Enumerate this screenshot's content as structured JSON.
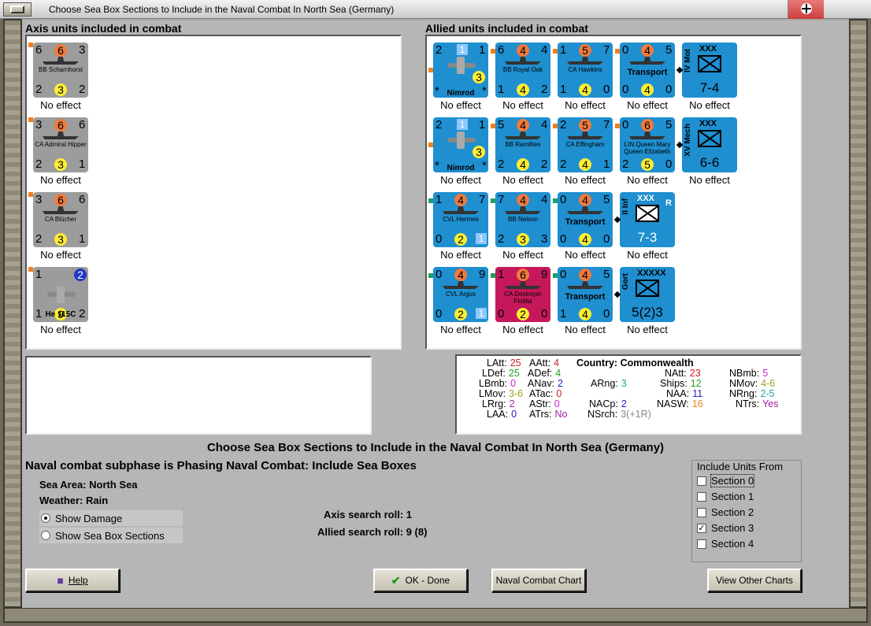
{
  "window": {
    "title": "Choose Sea Box Sections to Include in the Naval Combat In North Sea (Germany)"
  },
  "axis_panel": {
    "label": "Axis units included in combat"
  },
  "allied_panel": {
    "label": "Allied units included in combat"
  },
  "axis_units": [
    {
      "name": "BB Scharnhorst",
      "tl": "6",
      "circle": "6",
      "tr": "3",
      "bl": "2",
      "yc": "3",
      "br": "2",
      "effect": "No effect"
    },
    {
      "name": "CA Admiral Hipper",
      "tl": "3",
      "circle": "6",
      "tr": "6",
      "bl": "2",
      "yc": "3",
      "br": "1",
      "effect": "No effect"
    },
    {
      "name": "CA Blücher",
      "tl": "3",
      "circle": "6",
      "tr": "6",
      "bl": "2",
      "yc": "3",
      "br": "1",
      "effect": "No effect"
    },
    {
      "name": "He 115C",
      "tl": "1",
      "circle": "2",
      "bl": "1",
      "yc": "9",
      "br": "2",
      "effect": "No effect"
    }
  ],
  "allied_units": [
    {
      "name": "Nimrod",
      "tl": "2",
      "sq": "1",
      "tr": "1",
      "yc": "3",
      "star_l": "*",
      "star_r": "*",
      "effect": "No effect"
    },
    {
      "name": "BB Royal Oak",
      "tl": "6",
      "circle": "4",
      "tr": "4",
      "bl": "1",
      "yc": "4",
      "br": "2",
      "effect": "No effect"
    },
    {
      "name": "CA Hawkins",
      "tl": "1",
      "circle": "5",
      "tr": "7",
      "bl": "1",
      "yc": "4",
      "br": "0",
      "effect": "No effect"
    },
    {
      "name": "Transport",
      "tl": "0",
      "circle": "4",
      "tr": "5",
      "bl": "0",
      "yc": "4",
      "br": "0",
      "effect": "No effect"
    },
    {
      "name": "IV Mot",
      "type": "XXX",
      "strength": "7-4",
      "effect": "No effect"
    },
    {
      "name": "Nimrod",
      "tl": "2",
      "sq": "1",
      "tr": "1",
      "yc": "3",
      "star_l": "*",
      "star_r": "*",
      "effect": "No effect"
    },
    {
      "name": "BB Ramillies",
      "tl": "5",
      "circle": "4",
      "tr": "4",
      "bl": "2",
      "yc": "4",
      "br": "2",
      "effect": "No effect"
    },
    {
      "name": "CA Effingham",
      "tl": "2",
      "circle": "5",
      "tr": "7",
      "bl": "2",
      "yc": "4",
      "br": "1",
      "effect": "No effect"
    },
    {
      "name": "LIN Queen Mary Queen Elizabeth",
      "tl": "0",
      "circle": "6",
      "tr": "5",
      "bl": "2",
      "yc": "5",
      "br": "0",
      "effect": "No effect"
    },
    {
      "name": "XV Mech",
      "type": "XXX",
      "strength": "6-6",
      "effect": "No effect"
    },
    {
      "name": "CVL Hermes",
      "tl": "1",
      "circle": "4",
      "tr": "7",
      "bl": "0",
      "yc": "2",
      "sq": "1",
      "effect": "No effect"
    },
    {
      "name": "BB Nelson",
      "tl": "7",
      "circle": "4",
      "tr": "4",
      "bl": "2",
      "yc": "3",
      "br": "3",
      "effect": "No effect"
    },
    {
      "name": "Transport",
      "tl": "0",
      "circle": "4",
      "tr": "5",
      "bl": "0",
      "yc": "4",
      "br": "0",
      "effect": "No effect"
    },
    {
      "name": "II Inf",
      "type": "XXX",
      "extra": "R",
      "strength": "7-3",
      "effect": "No effect"
    },
    {
      "name": "CVL Argus",
      "tl": "0",
      "circle": "4",
      "tr": "9",
      "bl": "0",
      "yc": "2",
      "sq": "1",
      "effect": "No effect"
    },
    {
      "name": "CA Destroyer Flotilla",
      "tl": "1",
      "circle": "6",
      "tr": "9",
      "bl": "0",
      "yc": "2",
      "br": "0",
      "effect": "No effect"
    },
    {
      "name": "Transport",
      "tl": "0",
      "circle": "4",
      "tr": "5",
      "bl": "1",
      "yc": "4",
      "br": "0",
      "effect": "No effect"
    },
    {
      "name": "Gort",
      "type": "XXXXX",
      "strength": "5(2)3",
      "effect": "No effect"
    }
  ],
  "stats": {
    "country_label": "Country:",
    "country": "Commonwealth",
    "items": [
      {
        "k": "LAtt:",
        "v": "25",
        "c": "red"
      },
      {
        "k": "LDef:",
        "v": "25",
        "c": "grn"
      },
      {
        "k": "LBmb:",
        "v": "0",
        "c": "mag"
      },
      {
        "k": "LMov:",
        "v": "3-6",
        "c": "olv"
      },
      {
        "k": "LRrg:",
        "v": "2",
        "c": "pur"
      },
      {
        "k": "LAA:",
        "v": "0",
        "c": "blu"
      },
      {
        "k": "AAtt:",
        "v": "4",
        "c": "red"
      },
      {
        "k": "ADef:",
        "v": "4",
        "c": "grn"
      },
      {
        "k": "ANav:",
        "v": "2",
        "c": "blu"
      },
      {
        "k": "ATac:",
        "v": "0",
        "c": "red"
      },
      {
        "k": "AStr:",
        "v": "0",
        "c": "mag"
      },
      {
        "k": "ATrs:",
        "v": "No",
        "c": "pur"
      },
      {
        "k": "ARng:",
        "v": "3",
        "c": "teal"
      },
      {
        "k": "NACp:",
        "v": "2",
        "c": "blu"
      },
      {
        "k": "NSrch:",
        "v": "3(+1R)",
        "c": "gry"
      },
      {
        "k": "NAtt:",
        "v": "23",
        "c": "red"
      },
      {
        "k": "Ships:",
        "v": "12",
        "c": "grn"
      },
      {
        "k": "NAA:",
        "v": "11",
        "c": "blu"
      },
      {
        "k": "NASW:",
        "v": "16",
        "c": "orn"
      },
      {
        "k": "NBmb:",
        "v": "5",
        "c": "mag"
      },
      {
        "k": "NMov:",
        "v": "4-6",
        "c": "olv"
      },
      {
        "k": "NRng:",
        "v": "2-5",
        "c": "teal"
      },
      {
        "k": "NTrs:",
        "v": "Yes",
        "c": "pur"
      }
    ]
  },
  "heading": "Choose Sea Box Sections to Include in the Naval Combat In North Sea (Germany)",
  "subheading": "Naval combat subphase is Phasing Naval Combat: Include Sea Boxes",
  "sea_area": {
    "label": "Sea Area:",
    "value": "North Sea"
  },
  "weather": {
    "label": "Weather:",
    "value": "Rain"
  },
  "radios": {
    "show_damage": "Show Damage",
    "show_sections": "Show Sea Box Sections"
  },
  "axis_roll": "Axis search roll: 1",
  "allied_roll": "Allied search roll: 9 (8)",
  "include": {
    "label": "Include Units From",
    "sections": [
      {
        "label": "Section 0",
        "checked": false
      },
      {
        "label": "Section 1",
        "checked": false
      },
      {
        "label": "Section 2",
        "checked": false
      },
      {
        "label": "Section 3",
        "checked": true
      },
      {
        "label": "Section 4",
        "checked": false
      }
    ]
  },
  "buttons": {
    "help": "Help",
    "ok": "OK - Done",
    "naval_chart": "Naval Combat Chart",
    "other_charts": "View Other Charts"
  },
  "colors": {
    "frame": "#a9a9a4",
    "panel": "#ffffff",
    "counter_blue": "#1f8fd0",
    "counter_gray": "#9c9c9c",
    "counter_pink": "#c5185b"
  }
}
